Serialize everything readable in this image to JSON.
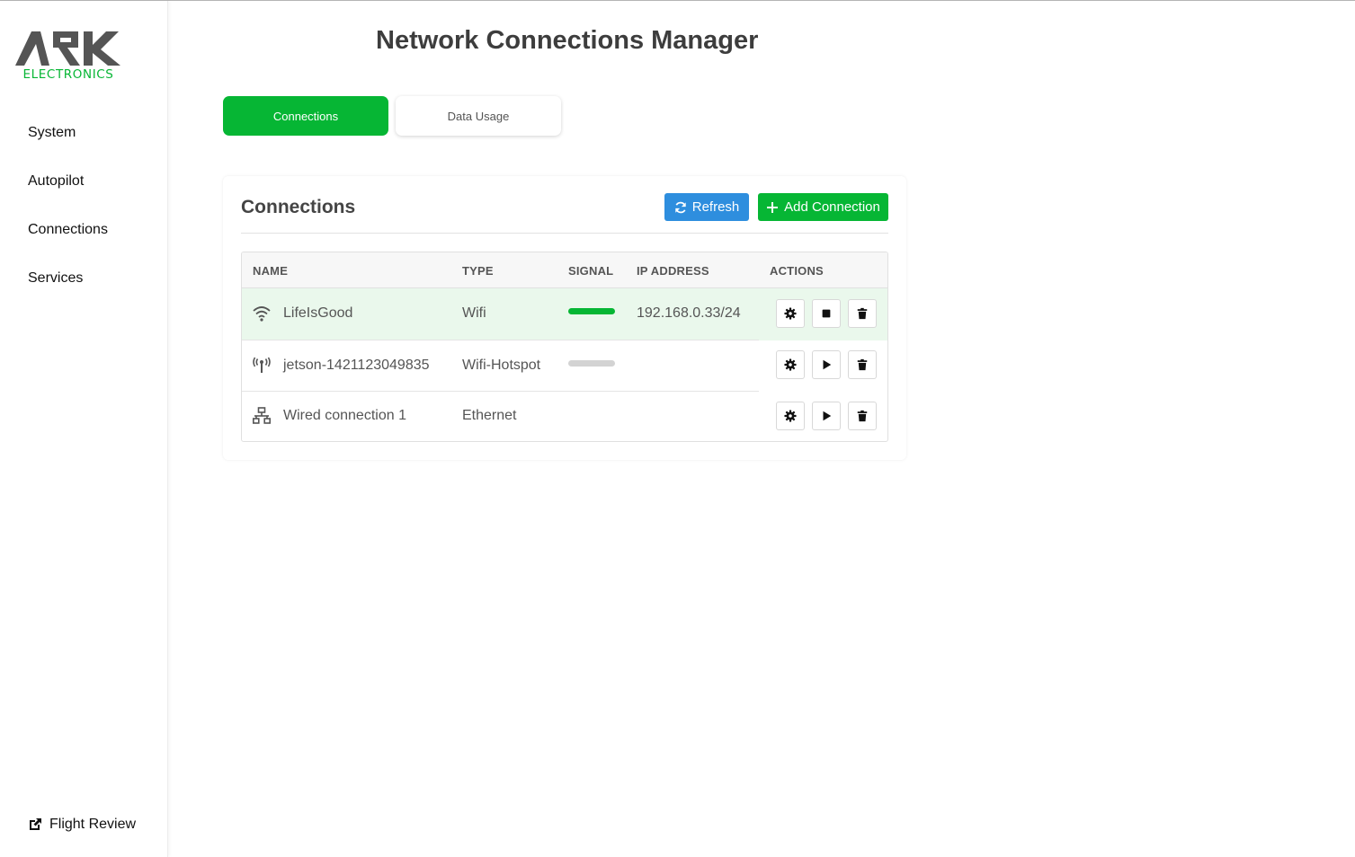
{
  "sidebar": {
    "logo_text": "ARK",
    "logo_subtext": "ELECTRONICS",
    "items": [
      {
        "label": "System"
      },
      {
        "label": "Autopilot"
      },
      {
        "label": "Connections"
      },
      {
        "label": "Services"
      }
    ],
    "footer_link": {
      "label": "Flight Review",
      "icon": "external-link-icon"
    }
  },
  "header": {
    "title": "Network Connections Manager"
  },
  "tabs": [
    {
      "label": "Connections",
      "active": true
    },
    {
      "label": "Data Usage",
      "active": false
    }
  ],
  "panel": {
    "title": "Connections",
    "refresh_label": "Refresh",
    "add_label": "Add Connection"
  },
  "table": {
    "columns": [
      "NAME",
      "TYPE",
      "SIGNAL",
      "IP ADDRESS",
      "ACTIONS"
    ],
    "rows": [
      {
        "name": "LifeIsGood",
        "type": "Wifi",
        "signal": 1.0,
        "ip": "192.168.0.33/24",
        "icon": "wifi-icon",
        "active": true,
        "toggle_icon": "stop-icon"
      },
      {
        "name": "jetson-1421123049835",
        "type": "Wifi-Hotspot",
        "signal": 0.0,
        "ip": "",
        "icon": "hotspot-icon",
        "active": false,
        "toggle_icon": "play-icon"
      },
      {
        "name": "Wired connection 1",
        "type": "Ethernet",
        "signal": null,
        "ip": "",
        "icon": "ethernet-icon",
        "active": false,
        "toggle_icon": "play-icon"
      }
    ]
  },
  "colors": {
    "accent_green": "#06b634",
    "accent_blue": "#2e8ede",
    "active_row": "#eaf8ec",
    "signal_empty": "#d3d3d3"
  }
}
